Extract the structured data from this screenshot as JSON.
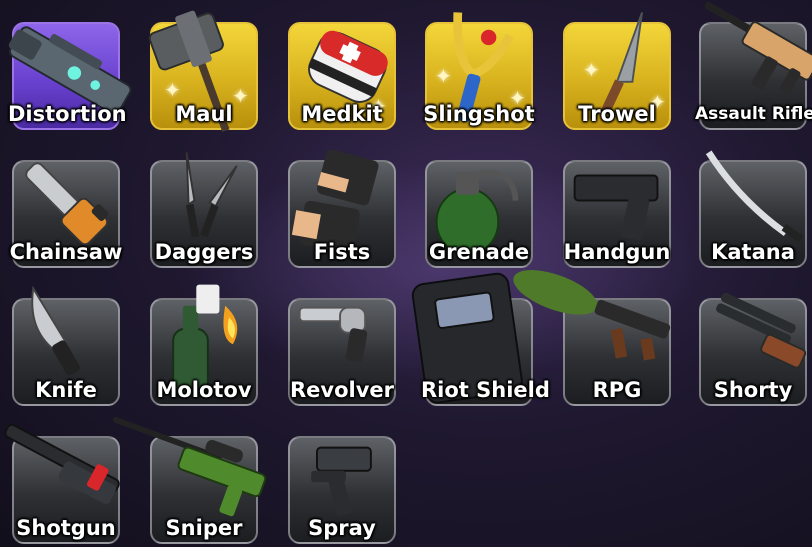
{
  "inventory": {
    "items": [
      {
        "label": "Distortion",
        "rarity": "purple",
        "icon": "distortion-gun-icon"
      },
      {
        "label": "Maul",
        "rarity": "gold",
        "icon": "maul-icon"
      },
      {
        "label": "Medkit",
        "rarity": "gold",
        "icon": "medkit-icon"
      },
      {
        "label": "Slingshot",
        "rarity": "gold",
        "icon": "slingshot-icon"
      },
      {
        "label": "Trowel",
        "rarity": "gold",
        "icon": "trowel-icon"
      },
      {
        "label": "Assault Rifle",
        "rarity": "common",
        "icon": "assault-rifle-icon"
      },
      {
        "label": "Chainsaw",
        "rarity": "common",
        "icon": "chainsaw-icon"
      },
      {
        "label": "Daggers",
        "rarity": "common",
        "icon": "daggers-icon"
      },
      {
        "label": "Fists",
        "rarity": "common",
        "icon": "fists-icon"
      },
      {
        "label": "Grenade",
        "rarity": "common",
        "icon": "grenade-icon"
      },
      {
        "label": "Handgun",
        "rarity": "common",
        "icon": "handgun-icon"
      },
      {
        "label": "Katana",
        "rarity": "common",
        "icon": "katana-icon"
      },
      {
        "label": "Knife",
        "rarity": "common",
        "icon": "knife-icon"
      },
      {
        "label": "Molotov",
        "rarity": "common",
        "icon": "molotov-icon"
      },
      {
        "label": "Revolver",
        "rarity": "common",
        "icon": "revolver-icon"
      },
      {
        "label": "Riot Shield",
        "rarity": "common",
        "icon": "riot-shield-icon"
      },
      {
        "label": "RPG",
        "rarity": "common",
        "icon": "rpg-icon"
      },
      {
        "label": "Shorty",
        "rarity": "common",
        "icon": "shorty-icon"
      },
      {
        "label": "Shotgun",
        "rarity": "common",
        "icon": "shotgun-icon"
      },
      {
        "label": "Sniper",
        "rarity": "common",
        "icon": "sniper-icon"
      },
      {
        "label": "Spray",
        "rarity": "common",
        "icon": "spray-icon"
      }
    ]
  },
  "colors": {
    "gold": "#f3d63a",
    "purple": "#8d66ea",
    "common": "#3a3c40",
    "label_text": "#ffffff"
  }
}
